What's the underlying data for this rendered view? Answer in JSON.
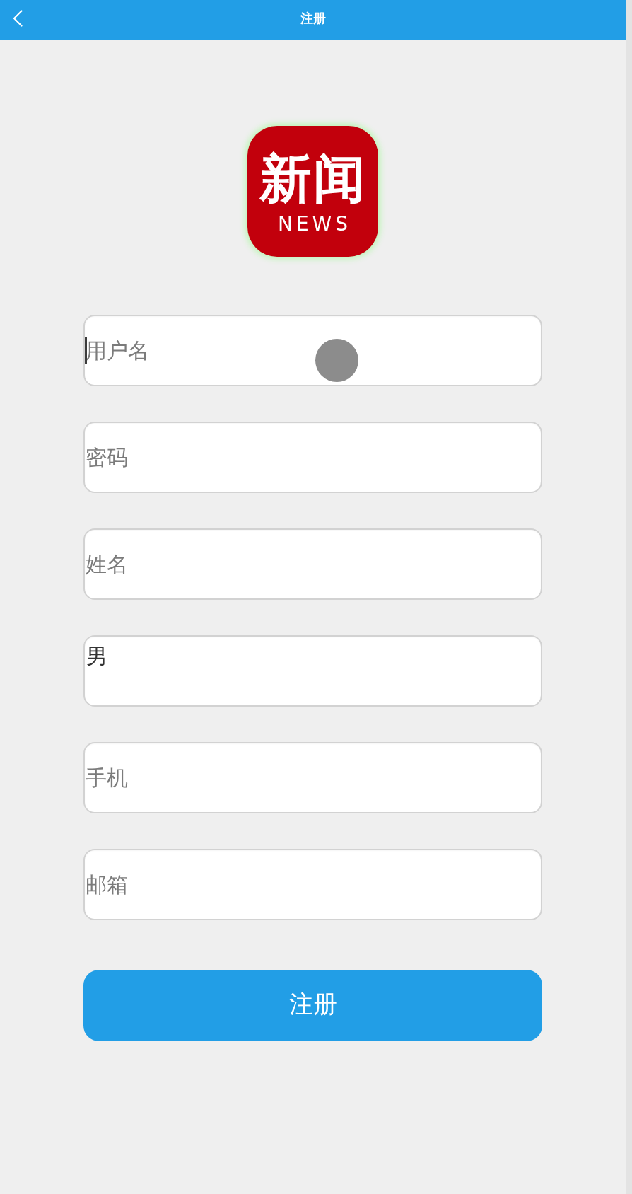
{
  "header": {
    "title": "注册"
  },
  "logo": {
    "title": "新闻",
    "subtitle": "NEWS"
  },
  "fields": [
    {
      "kind": "input",
      "placeholder": "用户名",
      "focused": true
    },
    {
      "kind": "input",
      "placeholder": "密码",
      "focused": false
    },
    {
      "kind": "input",
      "placeholder": "姓名",
      "focused": false
    },
    {
      "kind": "select",
      "value": "男",
      "focused": false
    },
    {
      "kind": "input",
      "placeholder": "手机",
      "focused": false
    },
    {
      "kind": "input",
      "placeholder": "邮箱",
      "focused": false
    }
  ],
  "submit_button": {
    "label": "注册"
  }
}
